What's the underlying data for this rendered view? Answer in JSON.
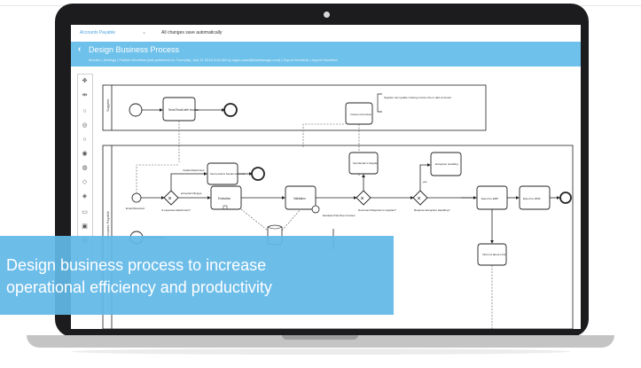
{
  "app": {
    "project_name": "Accounts Payable",
    "project_dropdown_icon": "chevron-down-icon",
    "save_status": "All changes save automatically"
  },
  "header": {
    "back_icon": "chevron-left-icon",
    "title": "Design Business Process",
    "subtitle": "Monitor | Settings | Publish Workflow (last published on Thursday, July 21 2016 5:46 AM by logan.ward@kissflowapp.com) | Export Workflow | Import Workflow"
  },
  "diagram": {
    "lanes": [
      "Supplier",
      "Accounts Payable"
    ],
    "nodes": {
      "send_email_invoice": "Send Email with Invoice",
      "supplier_note": "Supplier can update missing invoice info or add comment",
      "invoice_correction": "Invoice Correction",
      "send_email_sender": "Send email to Sender with error",
      "extraction": "Extraction",
      "validation": "Validation",
      "send_email_supplier": "Send Email to Supplier",
      "exception_handling": "Exception Handling",
      "export_erp": "Export to ERP",
      "export_dms": "Export to DMS",
      "inform_ap": "Inform A about error",
      "email_received": "Email Received",
      "invalid_attachment": "Invalid Attachment",
      "is_expected_attachment": "Is expected attachment?",
      "accepted_filetype": "accepted Filetype",
      "escalate_invoices": "Escalate Past Due Invoices",
      "document_rejected": "Document Rejected to supplier?",
      "requires_exception": "Requires Exception Handling?",
      "yes_label": "yes"
    }
  },
  "banner": {
    "line1": "Design business process to increase",
    "line2": "operational efficiency and productivity"
  }
}
